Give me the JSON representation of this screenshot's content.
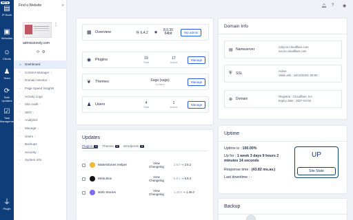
{
  "rail": {
    "beta": "BETA",
    "items": [
      {
        "label": "IP-Book"
      },
      {
        "label": "Websites"
      },
      {
        "label": "Clients"
      },
      {
        "label": "Team"
      },
      {
        "label": "Bulk Updates"
      },
      {
        "label": "Task Management"
      },
      {
        "label": "Plugin"
      }
    ]
  },
  "sidebar": {
    "search_placeholder": "Find a Website",
    "site_url": "admissionsly.com",
    "nav": [
      {
        "label": "Dashboard",
        "icon": "home-icon",
        "active": true
      },
      {
        "label": "Content Manager",
        "chev": "›"
      },
      {
        "label": "Domain Monitor",
        "chev": "›"
      },
      {
        "label": "Page Speed Insights"
      },
      {
        "label": "Activity Logs"
      },
      {
        "label": "Site Audit",
        "chev": "›"
      },
      {
        "label": "SEO",
        "chev": "›"
      },
      {
        "label": "Analytics"
      },
      {
        "label": "Manage",
        "chev": "›"
      },
      {
        "label": "Users",
        "chev": "›"
      },
      {
        "label": "Backups"
      },
      {
        "label": "Security",
        "chev": "›"
      },
      {
        "label": "System Info"
      }
    ]
  },
  "overview": {
    "label": "Overview",
    "wp_version": "6.4.2",
    "php_version": "8.0.30",
    "php_bits": "64bit",
    "wp_admin_button": "Wp admin"
  },
  "plugins": {
    "label": "Plugins",
    "total": "19",
    "total_label": "Total",
    "active": "17",
    "active_label": "Active",
    "button": "Manage"
  },
  "themes": {
    "label": "Themes",
    "current": "Suga (suga)",
    "current_label": "Current",
    "button": "Manage"
  },
  "users": {
    "label": "Users",
    "total": "4",
    "total_label": "Total",
    "active": "1",
    "active_label": "Active",
    "button": "Manage"
  },
  "domain_info": {
    "title": "Domain Info",
    "nameserver": {
      "label": "Nameserver",
      "value1": "coby.ns.cloudflare.com",
      "value2": "nia.ns.cloudflare.com"
    },
    "ssl": {
      "label": "SSL",
      "value1": "Active",
      "value2": "Valid until : 16/12/2023, 09:00"
    },
    "domain": {
      "label": "Domain",
      "value1": "Registrar : Cloudflare, Inc",
      "value2": "Expiry date : 2027-04-02"
    }
  },
  "updates": {
    "title": "Updates",
    "tabs": [
      {
        "label": "Plugins",
        "count": "3",
        "active": true
      },
      {
        "label": "Themes",
        "count": "0"
      },
      {
        "label": "Wordpress",
        "count": "0"
      }
    ],
    "rows": [
      {
        "name": "MakeStories Helper",
        "link1": "View",
        "link2": "Changelog",
        "from": "2.8.0",
        "to": "2.8.2",
        "color": "#f0b73a"
      },
      {
        "name": "Meta Box",
        "link1": "View",
        "link2": "Changelog",
        "from": "5.9.2",
        "to": "5.9.3",
        "color": "#111111"
      },
      {
        "name": "Web Stories",
        "link1": "View",
        "link2": "Changelog",
        "from": "1.34.0",
        "to": "1.35.0",
        "color": "#7b6cf0"
      }
    ]
  },
  "uptime": {
    "title": "Uptime",
    "uptime_label": "Uptime is :",
    "uptime_value": "100.00%",
    "upfor_label": "Up for :",
    "upfor_value1": "1 week 3 days 9 hours 2",
    "upfor_value2": "minutes 14 seconds",
    "response_label": "Response time :",
    "response_value": "(43.82 ms.av.)",
    "downtime_label": "Last downtime : -",
    "badge": "UP",
    "state": "Site State"
  },
  "backup": {
    "title": "Backup"
  }
}
